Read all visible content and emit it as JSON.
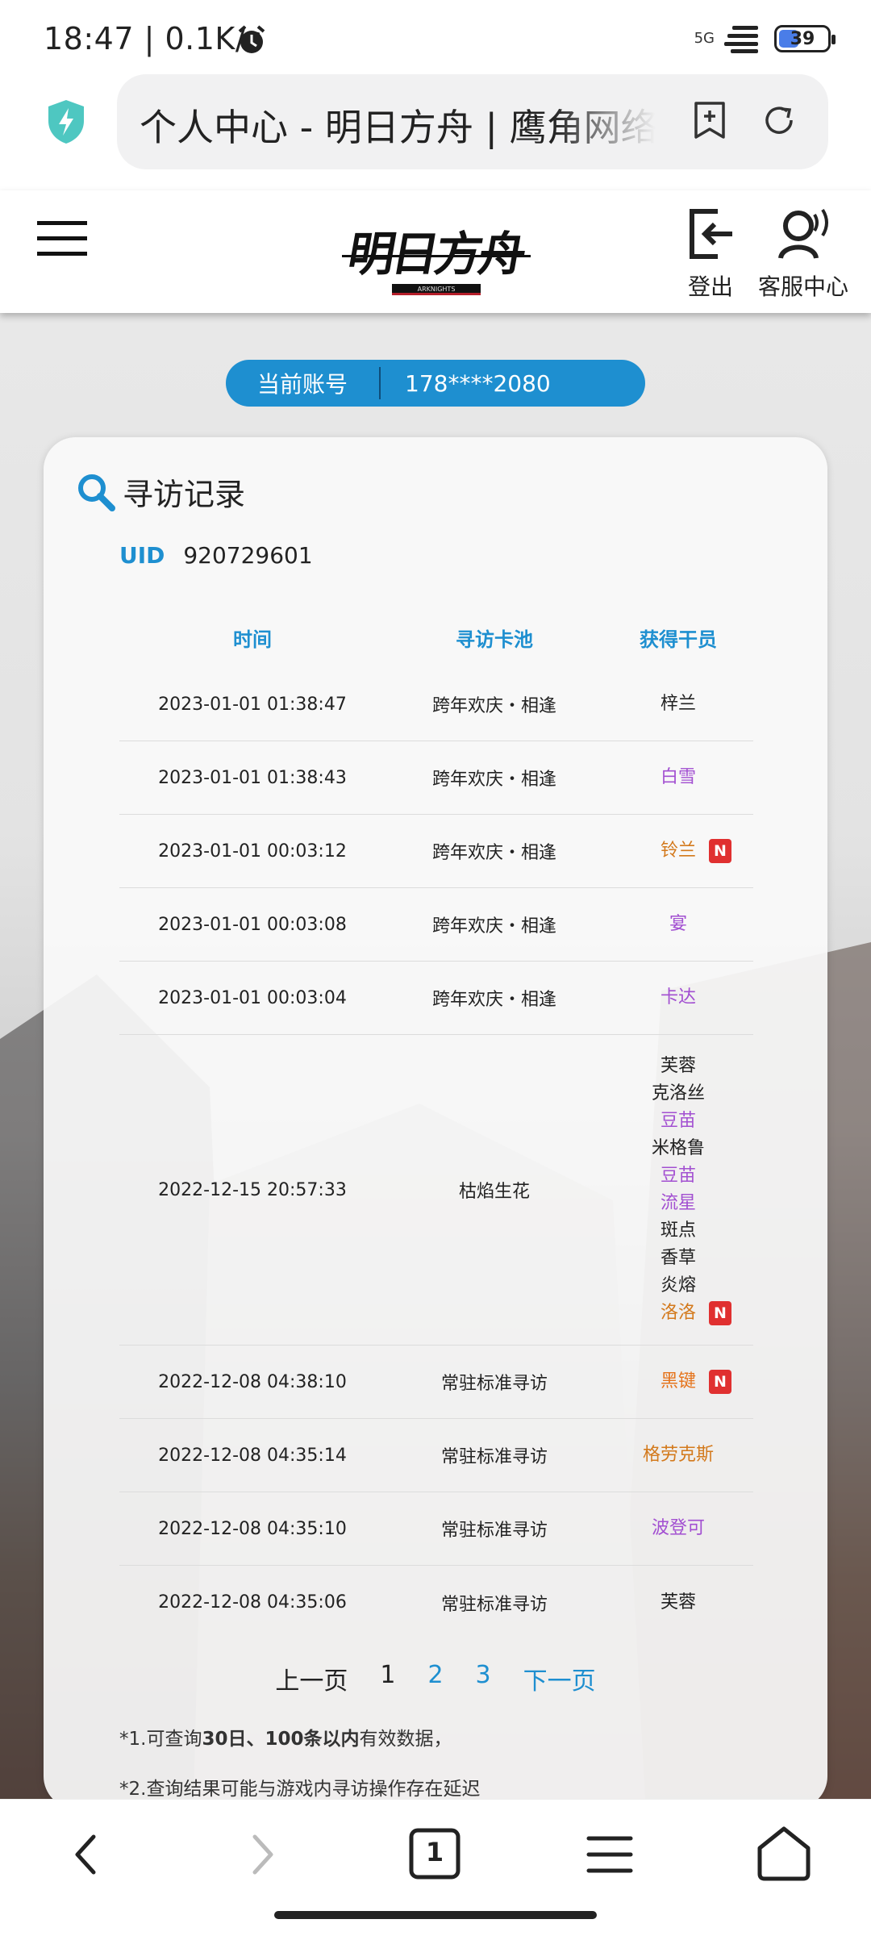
{
  "status_bar": {
    "time": "18:47 | 0.1K/s",
    "network": "5G",
    "battery_level": "39"
  },
  "browser": {
    "page_title": "个人中心 - 明日方舟 | 鹰角网络"
  },
  "site_header": {
    "logo_text": "明日方舟",
    "logo_subtext": "ARKNIGHTS",
    "logout_label": "登出",
    "service_label": "客服中心"
  },
  "account": {
    "label": "当前账号",
    "value": "178****2080"
  },
  "record": {
    "title": "寻访记录",
    "uid_label": "UID",
    "uid_value": "920729601",
    "columns": [
      "时间",
      "寻访卡池",
      "获得干员"
    ],
    "rows": [
      {
        "time": "2023-01-01 01:38:47",
        "pool": "跨年欢庆・相逢",
        "operators": [
          {
            "name": "梓兰",
            "rarity": 3,
            "new": false
          }
        ]
      },
      {
        "time": "2023-01-01 01:38:43",
        "pool": "跨年欢庆・相逢",
        "operators": [
          {
            "name": "白雪",
            "rarity": 4,
            "new": false
          }
        ]
      },
      {
        "time": "2023-01-01 00:03:12",
        "pool": "跨年欢庆・相逢",
        "operators": [
          {
            "name": "铃兰",
            "rarity": 5,
            "new": true
          }
        ]
      },
      {
        "time": "2023-01-01 00:03:08",
        "pool": "跨年欢庆・相逢",
        "operators": [
          {
            "name": "宴",
            "rarity": 4,
            "new": false
          }
        ]
      },
      {
        "time": "2023-01-01 00:03:04",
        "pool": "跨年欢庆・相逢",
        "operators": [
          {
            "name": "卡达",
            "rarity": 4,
            "new": false
          }
        ]
      },
      {
        "time": "2022-12-15 20:57:33",
        "pool": "枯焰生花",
        "operators": [
          {
            "name": "芙蓉",
            "rarity": 3,
            "new": false
          },
          {
            "name": "克洛丝",
            "rarity": 3,
            "new": false
          },
          {
            "name": "豆苗",
            "rarity": 4,
            "new": false
          },
          {
            "name": "米格鲁",
            "rarity": 3,
            "new": false
          },
          {
            "name": "豆苗",
            "rarity": 4,
            "new": false
          },
          {
            "name": "流星",
            "rarity": 4,
            "new": false
          },
          {
            "name": "斑点",
            "rarity": 3,
            "new": false
          },
          {
            "name": "香草",
            "rarity": 3,
            "new": false
          },
          {
            "name": "炎熔",
            "rarity": 3,
            "new": false
          },
          {
            "name": "洛洛",
            "rarity": 5,
            "new": true
          }
        ]
      },
      {
        "time": "2022-12-08 04:38:10",
        "pool": "常驻标准寻访",
        "operators": [
          {
            "name": "黑键",
            "rarity": 6,
            "new": true
          }
        ]
      },
      {
        "time": "2022-12-08 04:35:14",
        "pool": "常驻标准寻访",
        "operators": [
          {
            "name": "格劳克斯",
            "rarity": 5,
            "new": false
          }
        ]
      },
      {
        "time": "2022-12-08 04:35:10",
        "pool": "常驻标准寻访",
        "operators": [
          {
            "name": "波登可",
            "rarity": 4,
            "new": false
          }
        ]
      },
      {
        "time": "2022-12-08 04:35:06",
        "pool": "常驻标准寻访",
        "operators": [
          {
            "name": "芙蓉",
            "rarity": 3,
            "new": false
          }
        ]
      }
    ],
    "new_badge": "N"
  },
  "pager": {
    "prev": "上一页",
    "pages": [
      "1",
      "2",
      "3"
    ],
    "current": "1",
    "next": "下一页"
  },
  "notes": {
    "note1_prefix": "*1.可查询",
    "note1_bold1": "30日、100条以内",
    "note1_suffix": "有效数据，",
    "note2": "*2.查询结果可能与游戏内寻访操作存在延迟"
  },
  "bottom_nav": {
    "tab_count": "1"
  },
  "colors": {
    "accent": "#1e8fd0",
    "rarity3": "#222222",
    "rarity4": "#a24fd1",
    "rarity5": "#d3791c",
    "rarity6": "#e5741c",
    "new_badge": "#e03030"
  }
}
